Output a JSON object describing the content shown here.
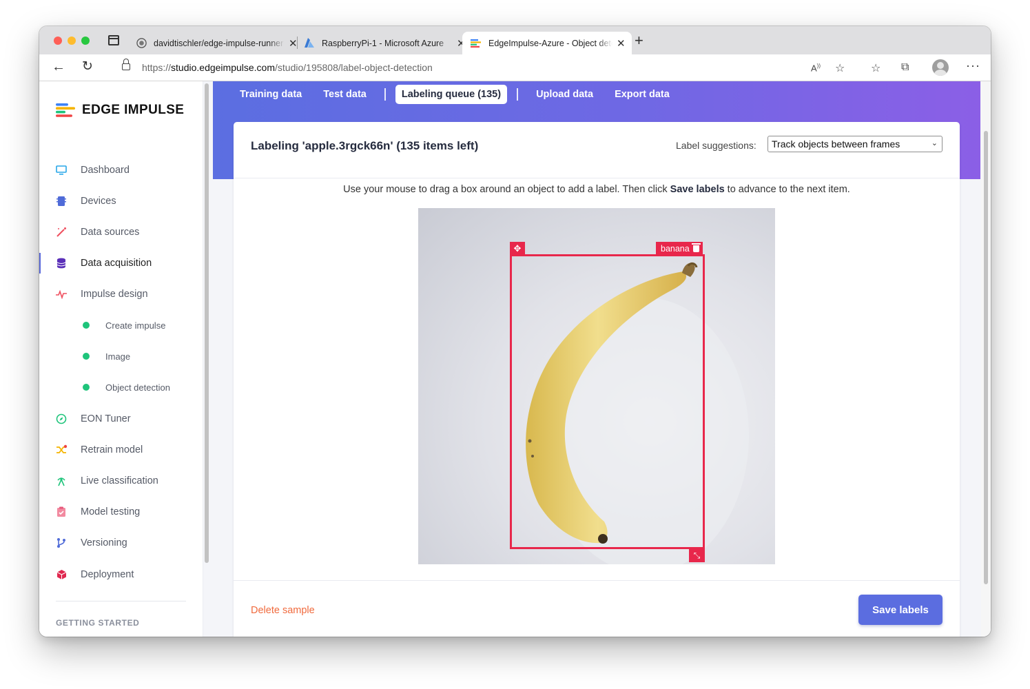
{
  "browser": {
    "tabs": [
      {
        "title": "davidtischler/edge-impulse-runner"
      },
      {
        "title": "RaspberryPi-1 - Microsoft Azure"
      },
      {
        "title": "EdgeImpulse-Azure - Object detection"
      }
    ],
    "active_tab_index": 2,
    "url_prefix": "https://",
    "url_host": "studio.edgeimpulse.com",
    "url_path": "/studio/195808/label-object-detection"
  },
  "sidebar": {
    "logo_text": "EDGE IMPULSE",
    "items": [
      {
        "label": "Dashboard",
        "icon": "monitor-icon"
      },
      {
        "label": "Devices",
        "icon": "chip-icon"
      },
      {
        "label": "Data sources",
        "icon": "magic-wand-icon"
      },
      {
        "label": "Data acquisition",
        "icon": "database-icon",
        "active": true
      },
      {
        "label": "Impulse design",
        "icon": "pulse-icon"
      },
      {
        "label": "Create impulse",
        "icon": "status-dot-icon"
      },
      {
        "label": "Image",
        "icon": "status-dot-icon"
      },
      {
        "label": "Object detection",
        "icon": "status-dot-icon"
      },
      {
        "label": "EON Tuner",
        "icon": "compass-icon"
      },
      {
        "label": "Retrain model",
        "icon": "shuffle-icon"
      },
      {
        "label": "Live classification",
        "icon": "broadcast-icon"
      },
      {
        "label": "Model testing",
        "icon": "clipboard-check-icon"
      },
      {
        "label": "Versioning",
        "icon": "git-branch-icon"
      },
      {
        "label": "Deployment",
        "icon": "package-icon"
      }
    ],
    "section_heading": "GETTING STARTED"
  },
  "subnav": {
    "tabs": [
      "Training data",
      "Test data",
      "Labeling queue (135)",
      "Upload data",
      "Export data"
    ],
    "active": "Labeling queue (135)"
  },
  "labeling": {
    "title": "Labeling 'apple.3rgck66n' (135 items left)",
    "suggestions_label": "Label suggestions:",
    "suggestions_value": "Track objects between frames",
    "instruction_before": "Use your mouse to drag a box around an object to add a label. Then click ",
    "instruction_bold": "Save labels",
    "instruction_after": " to advance to the next item.",
    "bounding_box_label": "banana",
    "delete_label": "Delete sample",
    "save_label": "Save labels"
  },
  "colors": {
    "accent": "#5b6de0",
    "bbox": "#e8274b",
    "delete": "#f06a3d",
    "status_dot": "#1fc47b"
  }
}
